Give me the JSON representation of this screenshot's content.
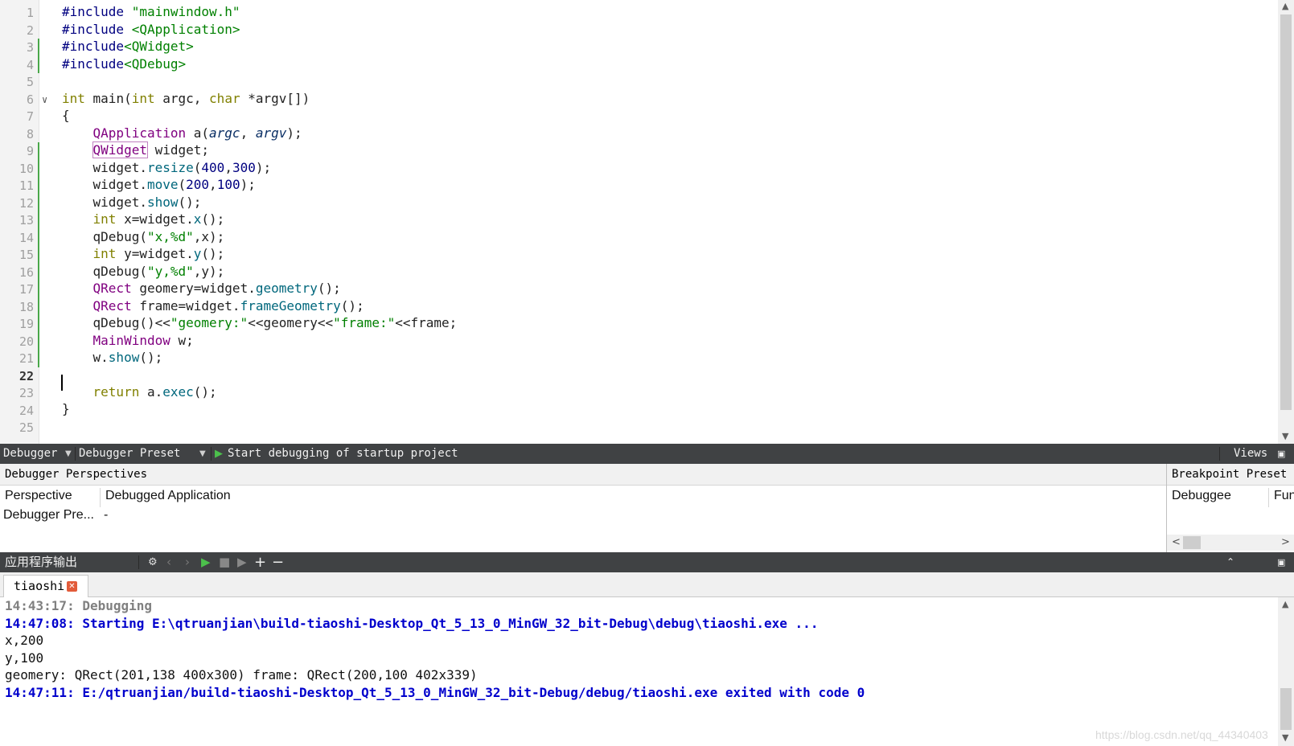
{
  "editor": {
    "line_numbers": [
      "1",
      "2",
      "3",
      "4",
      "5",
      "6",
      "7",
      "8",
      "9",
      "10",
      "11",
      "12",
      "13",
      "14",
      "15",
      "16",
      "17",
      "18",
      "19",
      "20",
      "21",
      "22",
      "23",
      "24",
      "25"
    ],
    "current_line": "22",
    "lines": {
      "l1_pp": "#include ",
      "l1_str": "\"mainwindow.h\"",
      "l2_pp": "#include ",
      "l2_str": "<QApplication>",
      "l3_pp": "#include",
      "l3_str": "<QWidget>",
      "l4_pp": "#include",
      "l4_str": "<QDebug>",
      "l6_int": "int",
      "l6_main": " main(",
      "l6_int2": "int",
      "l6_argc": " argc, ",
      "l6_char": "char",
      "l6_rest": " *argv[])",
      "l7": "{",
      "l8_ty": "QApplication",
      "l8_a": " a(",
      "l8_argc": "argc",
      "l8_sep": ", ",
      "l8_argv": "argv",
      "l8_end": ");",
      "l9_ty": "QWidget",
      "l9_rest": " widget;",
      "l10_w": "widget.",
      "l10_fn": "resize",
      "l10_o": "(",
      "l10_n1": "400",
      "l10_c": ",",
      "l10_n2": "300",
      "l10_e": ");",
      "l11_w": "widget.",
      "l11_fn": "move",
      "l11_o": "(",
      "l11_n1": "200",
      "l11_c": ",",
      "l11_n2": "100",
      "l11_e": ");",
      "l12_w": "widget.",
      "l12_fn": "show",
      "l12_e": "();",
      "l13_kw": "int",
      "l13_m": " x=widget.",
      "l13_fn": "x",
      "l13_e": "();",
      "l14_fn": "qDebug",
      "l14_o": "(",
      "l14_str": "\"x,%d\"",
      "l14_e": ",x);",
      "l15_kw": "int",
      "l15_m": " y=widget.",
      "l15_fn": "y",
      "l15_e": "();",
      "l16_fn": "qDebug",
      "l16_o": "(",
      "l16_str": "\"y,%d\"",
      "l16_e": ",y);",
      "l17_ty": "QRect",
      "l17_m": " geomery=widget.",
      "l17_fn": "geometry",
      "l17_e": "();",
      "l18_ty": "QRect",
      "l18_m": " frame=widget.",
      "l18_fn": "frameGeometry",
      "l18_e": "();",
      "l19_fn": "qDebug",
      "l19_a": "()<<",
      "l19_s1": "\"geomery:\"",
      "l19_b": "<<geomery<<",
      "l19_s2": "\"frame:\"",
      "l19_c": "<<frame;",
      "l20_ty": "MainWindow",
      "l20_rest": " w;",
      "l21_w": "w.",
      "l21_fn": "show",
      "l21_e": "();",
      "l23_kw": "return",
      "l23_m": " a.",
      "l23_fn": "exec",
      "l23_e": "();",
      "l24": "}"
    }
  },
  "debugger_toolbar": {
    "debugger_label": "Debugger",
    "preset_label": "Debugger Preset",
    "start_label": "Start debugging of startup project",
    "views_label": "Views"
  },
  "perspectives": {
    "title": "Debugger Perspectives",
    "col1_header": "Perspective",
    "col2_header": "Debugged Application",
    "row1_col1": "Debugger Pre...",
    "row1_col2": "-"
  },
  "breakpoint_preset": {
    "title": "Breakpoint Preset",
    "col1_header": "Debuggee",
    "col2_header": "Fun"
  },
  "output_toolbar": {
    "title": "应用程序输出"
  },
  "output_tabs": [
    {
      "label": "tiaoshi"
    }
  ],
  "output_lines": [
    "14:43:17: Debugging",
    "14:47:08: Starting E:\\qtruanjian\\build-tiaoshi-Desktop_Qt_5_13_0_MinGW_32_bit-Debug\\debug\\tiaoshi.exe ...",
    "x,200",
    "y,100",
    "geomery: QRect(201,138 400x300) frame: QRect(200,100 402x339)",
    "14:47:11: E:/qtruanjian/build-tiaoshi-Desktop_Qt_5_13_0_MinGW_32_bit-Debug/debug/tiaoshi.exe exited with code 0"
  ],
  "watermark": "https://blog.csdn.net/qq_44340403",
  "colors": {
    "toolbar_bg": "#404244",
    "preprocessor": "#000080",
    "string": "#008000",
    "keyword": "#808000",
    "type": "#800080",
    "output_info": "#0000cc"
  }
}
